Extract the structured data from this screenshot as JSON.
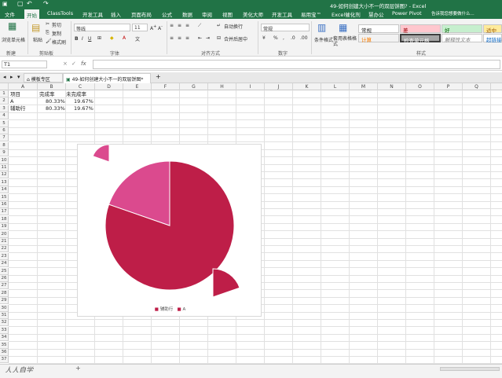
{
  "window": {
    "title": "49-如何创建大小不一的双层饼图? - Excel",
    "user_hint": "告诉我您想要做什么..."
  },
  "ribbon_tabs": [
    "文件",
    "开始",
    "ClassTools",
    "开发工具",
    "插入",
    "页面布局",
    "公式",
    "数据",
    "审阅",
    "视图",
    "美化大师",
    "开发工具",
    "易用宝™",
    "Excel催化剂",
    "慧办公",
    "Power Pivot"
  ],
  "ribbon": {
    "groups": {
      "newgroup": "新建",
      "clipboard": "剪贴板",
      "font": "字体",
      "align": "对齐方式",
      "number": "数字",
      "styles": "样式"
    },
    "buttons": {
      "browse": "浏览单元格",
      "paste": "粘贴",
      "cut": "剪切",
      "copy": "复制",
      "format_painter": "格式刷",
      "wrap": "自动换行",
      "merge": "合并后居中",
      "cond_format": "条件格式",
      "table_format": "套用表格格式"
    },
    "font_name": "等线",
    "font_size": "11",
    "number_format": "常规",
    "styles": {
      "normal": "常规",
      "bad": "差",
      "good": "好",
      "neutral": "适中",
      "calc": "计算",
      "check": "检查单元格",
      "explain": "解释性文本",
      "hyper": "超链接"
    }
  },
  "formula_bar": {
    "name_box": "T1",
    "cancel": "×",
    "confirm": "✓",
    "fx": "fx",
    "value": ""
  },
  "workbook_tabs": {
    "t1": "模板专区",
    "t2": "49-如何创建大小不一的双层饼图*",
    "add": "+"
  },
  "columns": [
    "A",
    "B",
    "C",
    "D",
    "E",
    "F",
    "G",
    "H",
    "I",
    "J",
    "K",
    "L",
    "M",
    "N",
    "O",
    "P",
    "Q",
    "R"
  ],
  "rows": [
    "1",
    "2",
    "3",
    "4",
    "5",
    "6",
    "7",
    "8",
    "9",
    "10",
    "11",
    "12",
    "13",
    "14",
    "15",
    "16",
    "17",
    "18",
    "19",
    "20",
    "21",
    "22",
    "23",
    "24",
    "25",
    "26",
    "27",
    "28",
    "29",
    "30",
    "31",
    "32",
    "33",
    "34",
    "35",
    "36",
    "37",
    "38"
  ],
  "table": {
    "headers": [
      "项目",
      "完成率",
      "未完成率"
    ],
    "rows": [
      [
        "A",
        "80.33%",
        "19.67%"
      ],
      [
        "辅助行",
        "80.33%",
        "19.67%"
      ]
    ]
  },
  "chart_data": {
    "type": "pie",
    "series": [
      {
        "name": "辅助行",
        "values": [
          80.33,
          19.67
        ]
      },
      {
        "name": "A",
        "values": [
          80.33,
          19.67
        ]
      }
    ],
    "categories": [
      "完成率",
      "未完成率"
    ],
    "legend": [
      "辅助行",
      "A"
    ],
    "legend_position": "bottom",
    "colors": {
      "main": "#be1e48",
      "light": "#db4a8e",
      "outline": "#ffffff"
    }
  },
  "sheet_bar": {
    "add": "+",
    "watermark": "人人自学"
  }
}
